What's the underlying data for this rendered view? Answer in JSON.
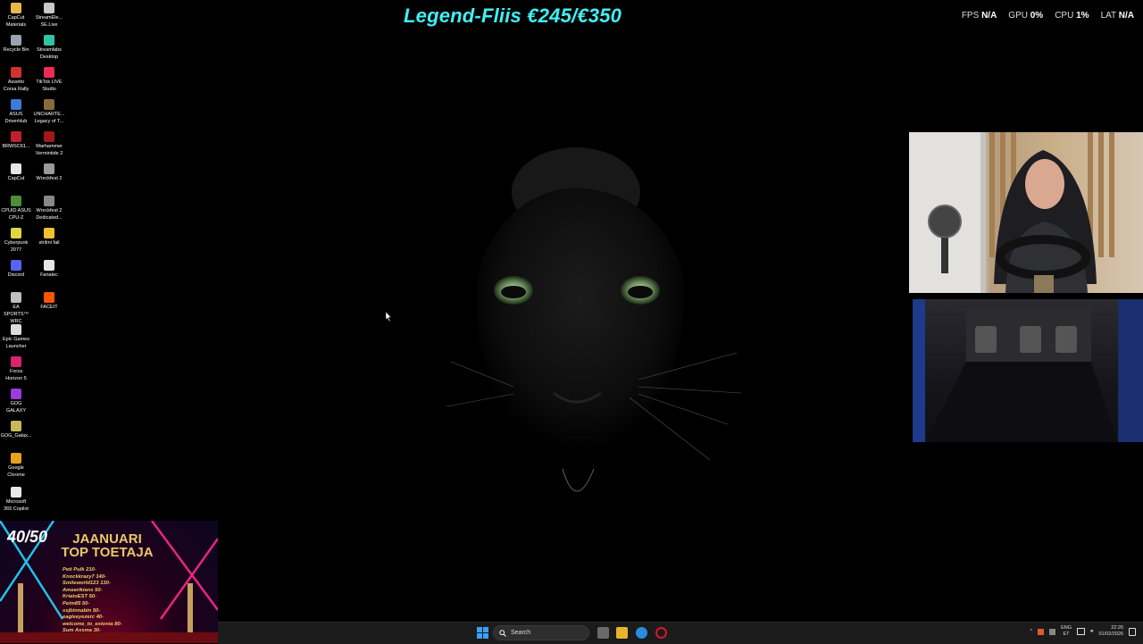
{
  "overlay": {
    "title": "Legend-Fliis €245/€350",
    "stats": [
      {
        "label": "FPS",
        "value": "N/A"
      },
      {
        "label": "GPU",
        "value": "0%"
      },
      {
        "label": "CPU",
        "value": "1%"
      },
      {
        "label": "LAT",
        "value": "N/A"
      }
    ]
  },
  "desktop_icons": [
    {
      "label": "CapCut\nMaterials",
      "color": "#e8b84a"
    },
    {
      "label": "StreamEle...\nSE.Live",
      "color": "#c8c8c8"
    },
    {
      "label": "Recycle Bin",
      "color": "#9aa3b2"
    },
    {
      "label": "Streamlabs\nDesktop",
      "color": "#31c3a2"
    },
    {
      "label": "Assetto\nCorsa Rally",
      "color": "#d33030"
    },
    {
      "label": "TikTok LIVE\nStudio",
      "color": "#ee2a55"
    },
    {
      "label": "ASUS\nDriverHub",
      "color": "#3b7bd9"
    },
    {
      "label": "UNCHARTE...\nLegacy of T...",
      "color": "#8a6a3a"
    },
    {
      "label": "BRWSC61...",
      "color": "#c0202a"
    },
    {
      "label": "Warhammer\nVermintide 2",
      "color": "#a01818"
    },
    {
      "label": "CapCut",
      "color": "#e6e6e6"
    },
    {
      "label": "Wreckfest 2",
      "color": "#9a9a9a"
    },
    {
      "label": "CPUID ASUS\nCPU-Z",
      "color": "#4c8e3a"
    },
    {
      "label": "Wreckfest 2\nDedicated...",
      "color": "#888888"
    },
    {
      "label": "Cyberpunk\n2077",
      "color": "#e0d640"
    },
    {
      "label": "strilmi fail",
      "color": "#f0c030"
    },
    {
      "label": "Discord",
      "color": "#5865f2"
    },
    {
      "label": "Fanatec",
      "color": "#e6e6e6"
    },
    {
      "label": "EA SPORTS™\nWRC",
      "color": "#bfbfbf"
    },
    {
      "label": "FACEIT",
      "color": "#ff5500"
    },
    {
      "label": "Epic Games\nLauncher",
      "color": "#dcdcdc"
    },
    {
      "label": "Forza\nHorizon 5",
      "color": "#d8246e"
    },
    {
      "label": "GOG\nGALAXY",
      "color": "#9b3bdb"
    },
    {
      "label": "GOG_Galax...",
      "color": "#c8b85a"
    },
    {
      "label": "Google\nChrome",
      "color": "#e5a21a"
    },
    {
      "label": "Microsoft\n365 Copilot",
      "color": "#e8e8e8"
    }
  ],
  "banner": {
    "count": "40/50",
    "title": "JAANUARI\nTOP TOETAJA",
    "list": [
      "Peti Pulk 210-",
      "Knockkrazy7 140-",
      "Smileworld123 130-",
      "Ameerikians 50-",
      "KriatoEST 50-",
      "Peim85 50-",
      "ssjbinnabin 50-",
      "eagleeyezerc 40-",
      "welcome_to_estonia 80-",
      "Sum Assma 30-"
    ]
  },
  "taskbar": {
    "search_placeholder": "Search",
    "lang_top": "ENG",
    "lang_bottom": "ET",
    "time": "22:26",
    "date": "01/02/2026"
  }
}
